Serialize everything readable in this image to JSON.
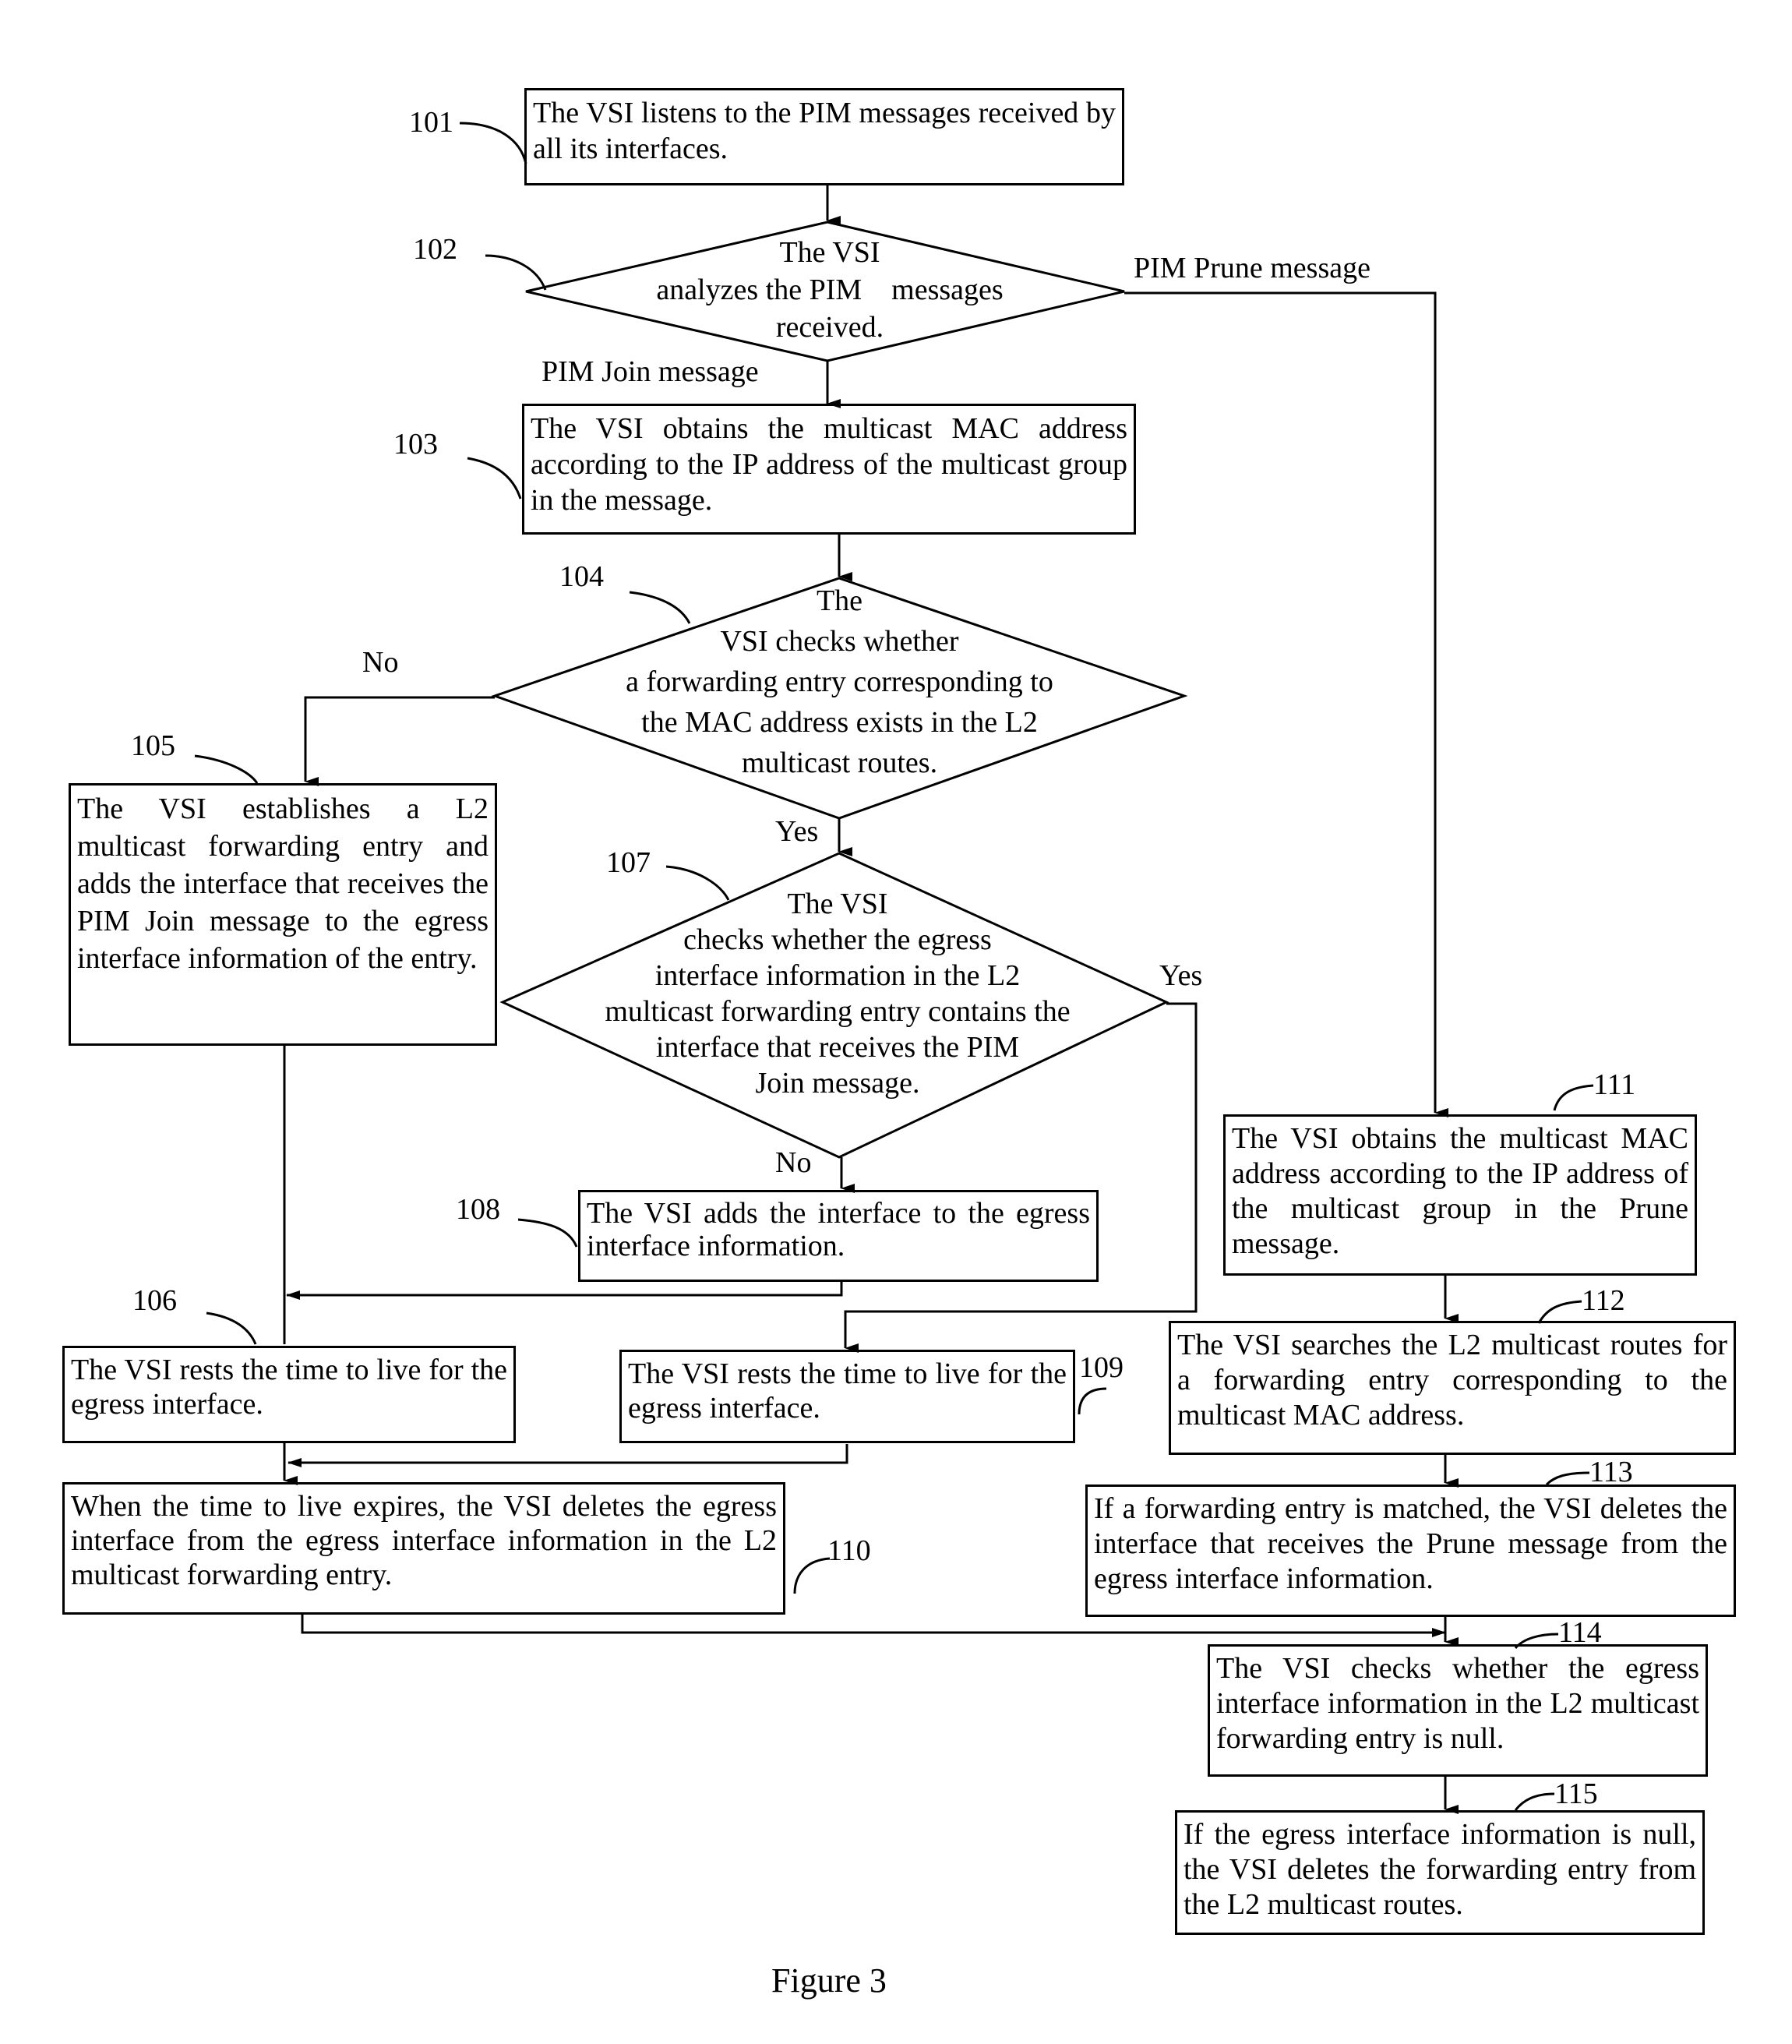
{
  "figure_caption": "Figure 3",
  "steps": {
    "s101": {
      "num": "101",
      "text": "The VSI listens to the PIM messages received by all its interfaces."
    },
    "s102": {
      "num": "102",
      "lines": [
        "The VSI",
        "analyzes the PIM    messages",
        "received."
      ]
    },
    "s103": {
      "num": "103",
      "text": "The VSI obtains the multicast MAC address according to the IP address of the multicast group in the message."
    },
    "s104": {
      "num": "104",
      "lines": [
        "The",
        "VSI checks whether",
        "a forwarding entry corresponding to",
        "the MAC address exists in the L2",
        "multicast routes."
      ]
    },
    "s105": {
      "num": "105",
      "text": "The VSI establishes a L2 multicast forwarding entry and adds the interface that receives the PIM Join message to the egress interface information of the entry."
    },
    "s106": {
      "num": "106",
      "text": "The VSI rests the time to live for the egress interface."
    },
    "s107": {
      "num": "107",
      "lines": [
        "The VSI",
        "checks whether the egress",
        "interface information in the L2",
        "multicast forwarding entry contains the",
        "interface that receives the PIM",
        "Join message."
      ]
    },
    "s108": {
      "num": "108",
      "text": "The VSI adds the interface to the egress interface information."
    },
    "s109": {
      "num": "109",
      "text": "The VSI rests the time to live for the egress interface."
    },
    "s110": {
      "num": "110",
      "text": "When the time to live expires, the VSI deletes the egress interface from the egress interface information in the L2 multicast forwarding entry."
    },
    "s111": {
      "num": "111",
      "text": "The VSI obtains the multicast MAC address according to the IP address of the multicast group in the Prune message."
    },
    "s112": {
      "num": "112",
      "text": "The VSI searches the L2 multicast routes for a forwarding entry corresponding to the multicast MAC address."
    },
    "s113": {
      "num": "113",
      "text": "If a forwarding entry is matched, the VSI deletes the interface that receives the Prune message from the egress interface information."
    },
    "s114": {
      "num": "114",
      "text": "The VSI checks whether the egress interface information in the L2 multicast forwarding entry is null."
    },
    "s115": {
      "num": "115",
      "text": "If the egress interface information is null, the VSI deletes the forwarding entry from the L2 multicast routes."
    }
  },
  "edge_labels": {
    "prune": "PIM Prune message",
    "join": "PIM Join message",
    "no_104": "No",
    "yes_104": "Yes",
    "yes_107": "Yes",
    "no_107": "No"
  }
}
